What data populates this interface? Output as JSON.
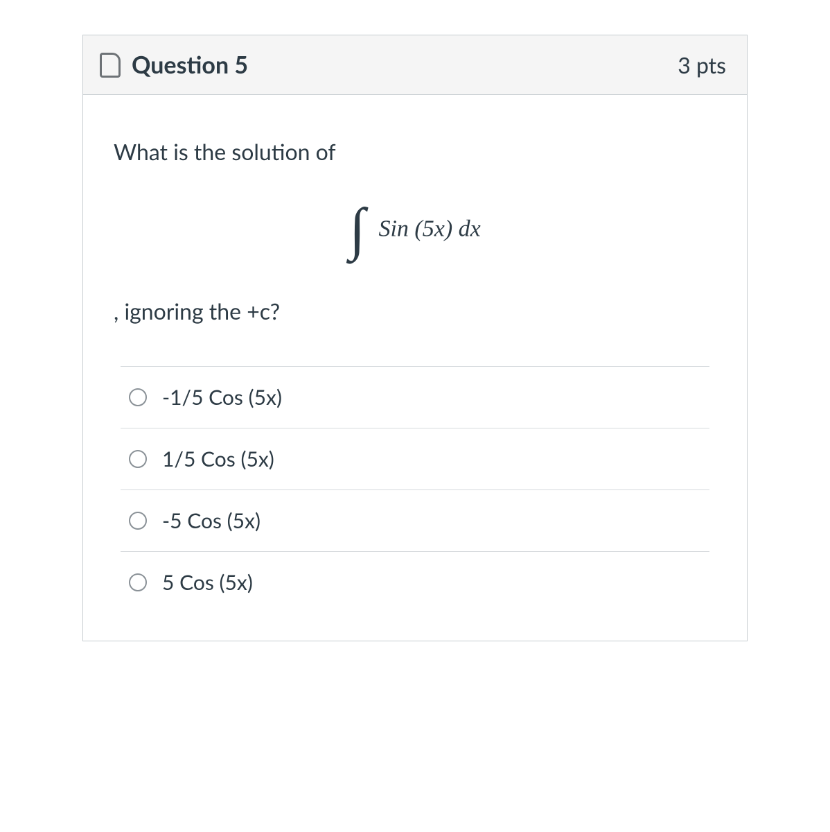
{
  "header": {
    "title": "Question 5",
    "points": "3 pts"
  },
  "question": {
    "line1": "What is the solution of",
    "integral_sign": "∫",
    "integrand": "Sin (5x) dx",
    "line2": ", ignoring the +c?"
  },
  "options": [
    {
      "label": "-1/5 Cos (5x)"
    },
    {
      "label": "1/5 Cos (5x)"
    },
    {
      "label": "-5 Cos (5x)"
    },
    {
      "label": "5 Cos (5x)"
    }
  ]
}
